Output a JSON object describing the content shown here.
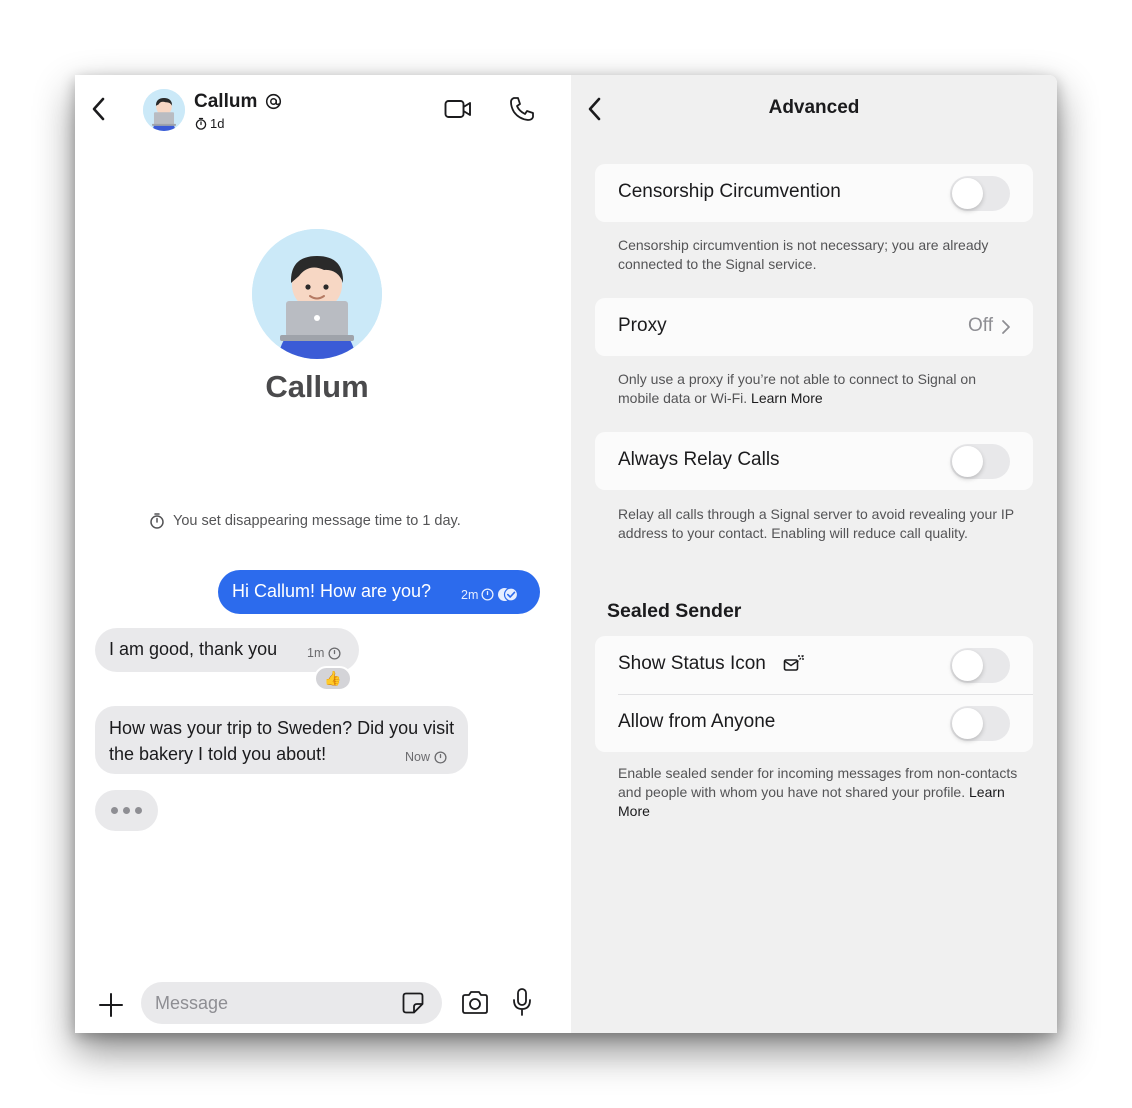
{
  "chat": {
    "contact_name": "Callum",
    "timer_label": "1d",
    "big_name": "Callum",
    "system_message": "You set disappearing message time to 1 day.",
    "messages": [
      {
        "direction": "outgoing",
        "text": "Hi Callum! How are you?",
        "time": "2m"
      },
      {
        "direction": "incoming",
        "text": "I am good, thank you",
        "time": "1m",
        "reaction": "👍"
      },
      {
        "direction": "incoming",
        "text": "How was your trip to Sweden? Did you visit the bakery I told you about!",
        "time": "Now"
      }
    ],
    "composer": {
      "placeholder": "Message"
    }
  },
  "settings": {
    "title": "Advanced",
    "censorship": {
      "label": "Censorship Circumvention",
      "enabled": false,
      "footer": "Censorship circumvention is not necessary; you are already connected to the Signal service."
    },
    "proxy": {
      "label": "Proxy",
      "value": "Off",
      "footer": "Only use a proxy if you’re not able to connect to Signal on mobile data or Wi-Fi.",
      "link": "Learn More"
    },
    "relay": {
      "label": "Always Relay Calls",
      "enabled": false,
      "footer": "Relay all calls through a Signal server to avoid revealing your IP address to your contact. Enabling will reduce call quality."
    },
    "sealed_sender": {
      "header": "Sealed Sender",
      "show_status_label": "Show Status Icon",
      "show_status_enabled": false,
      "allow_anyone_label": "Allow from Anyone",
      "allow_anyone_enabled": false,
      "footer": "Enable sealed sender for incoming messages from non-contacts and people with whom you have not shared your profile.",
      "link": "Learn More"
    }
  },
  "colors": {
    "outgoing_bubble": "#2c6bed",
    "incoming_bubble": "#e9e9eb",
    "settings_background": "#f0f0f0"
  }
}
